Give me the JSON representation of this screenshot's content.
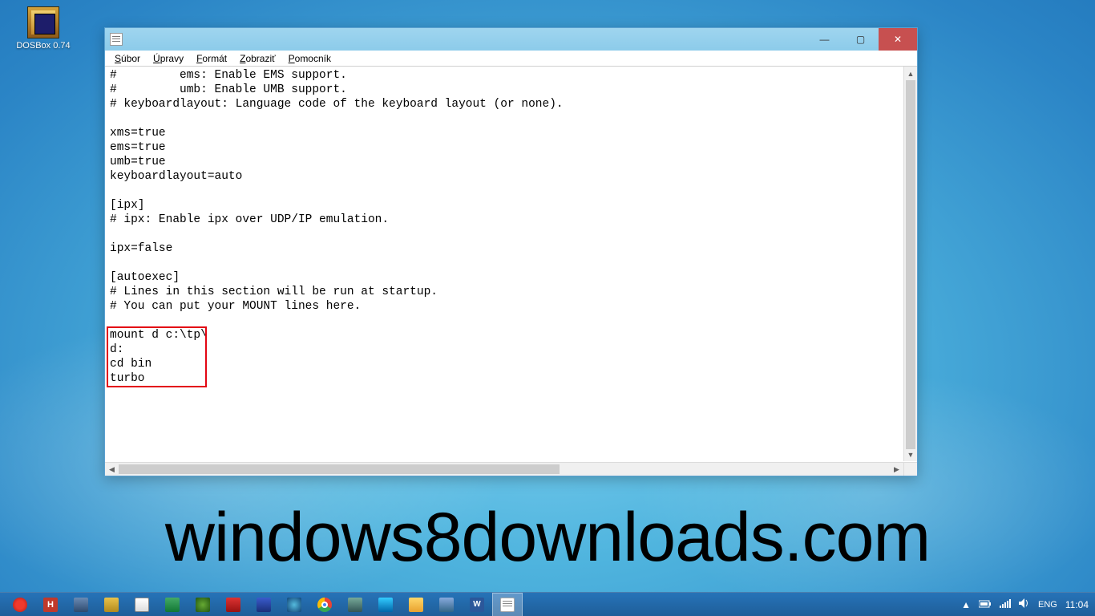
{
  "desktop": {
    "icon_label": "DOSBox 0.74"
  },
  "window": {
    "menus": [
      "Súbor",
      "Úpravy",
      "Formát",
      "Zobraziť",
      "Pomocník"
    ],
    "menu_underline_idx": [
      0,
      0,
      0,
      0,
      0
    ],
    "content_lines": [
      "#         ems: Enable EMS support.",
      "#         umb: Enable UMB support.",
      "# keyboardlayout: Language code of the keyboard layout (or none).",
      "",
      "xms=true",
      "ems=true",
      "umb=true",
      "keyboardlayout=auto",
      "",
      "[ipx]",
      "# ipx: Enable ipx over UDP/IP emulation.",
      "",
      "ipx=false",
      "",
      "[autoexec]",
      "# Lines in this section will be run at startup.",
      "# You can put your MOUNT lines here.",
      "",
      "mount d c:\\tp\\",
      "d:",
      "cd bin",
      "turbo"
    ],
    "highlight": {
      "from_line": 18,
      "to_line": 21
    }
  },
  "watermark": "windows8downloads.com",
  "taskbar": {
    "items": [
      {
        "name": "opera-icon",
        "cls": "o",
        "label": ""
      },
      {
        "name": "app-h-icon",
        "cls": "h",
        "label": "H"
      },
      {
        "name": "picture-viewer-icon",
        "cls": "pic",
        "label": ""
      },
      {
        "name": "totalcmd-icon",
        "cls": "tc",
        "label": ""
      },
      {
        "name": "paint-icon",
        "cls": "paint",
        "label": ""
      },
      {
        "name": "image-app-icon",
        "cls": "img",
        "label": ""
      },
      {
        "name": "media-app-icon",
        "cls": "dog",
        "label": ""
      },
      {
        "name": "pdf-reader-icon",
        "cls": "pdf",
        "label": ""
      },
      {
        "name": "floppy-save-icon",
        "cls": "floppy",
        "label": ""
      },
      {
        "name": "thunderbird-icon",
        "cls": "tbird",
        "label": ""
      },
      {
        "name": "chrome-icon",
        "cls": "chrome",
        "label": ""
      },
      {
        "name": "link-app-icon",
        "cls": "link",
        "label": ""
      },
      {
        "name": "game-app-icon",
        "cls": "game",
        "label": ""
      },
      {
        "name": "file-explorer-icon",
        "cls": "folder",
        "label": ""
      },
      {
        "name": "utility-app-icon",
        "cls": "app",
        "label": ""
      },
      {
        "name": "word-icon",
        "cls": "word",
        "label": "W"
      },
      {
        "name": "notepad-icon",
        "cls": "notepad",
        "label": "",
        "active": true
      }
    ]
  },
  "tray": {
    "show_hidden": "▲",
    "lang": "ENG",
    "clock": "11:04"
  }
}
